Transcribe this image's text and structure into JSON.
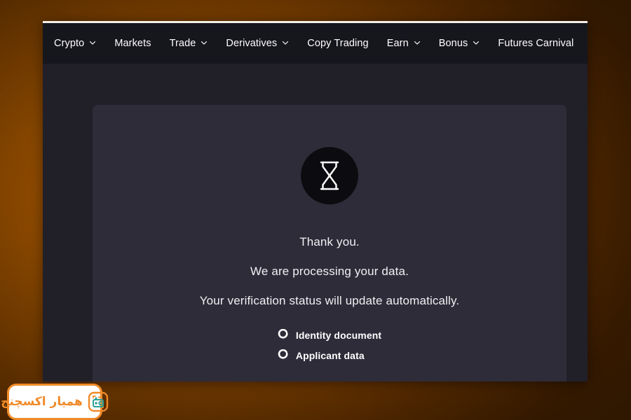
{
  "nav": {
    "items": [
      {
        "label": "Crypto",
        "has_chevron": true
      },
      {
        "label": "Markets",
        "has_chevron": false
      },
      {
        "label": "Trade",
        "has_chevron": true
      },
      {
        "label": "Derivatives",
        "has_chevron": true
      },
      {
        "label": "Copy Trading",
        "has_chevron": false
      },
      {
        "label": "Earn",
        "has_chevron": true
      },
      {
        "label": "Bonus",
        "has_chevron": true
      },
      {
        "label": "Futures Carnival",
        "has_chevron": false
      }
    ]
  },
  "card": {
    "icon": "hourglass-icon",
    "message_line_1": "Thank you.",
    "message_line_2": "We are processing your data.",
    "message_line_3": "Your verification status will update automatically.",
    "status_items": [
      {
        "label": "Identity document",
        "icon": "spinner-icon"
      },
      {
        "label": "Applicant data",
        "icon": "spinner-icon"
      }
    ]
  },
  "watermark": {
    "text": "همیار اکسچنج",
    "icon": "exchange-wallet-logo"
  },
  "colors": {
    "page_background": "#212029",
    "nav_background": "#16161d",
    "card_background": "#2e2c39",
    "icon_circle": "#0c0c10",
    "text_primary": "#f0f0f3",
    "accent_orange": "#f08a28",
    "accent_green": "#2aa198",
    "desktop_gradient_from": "#9b5200",
    "desktop_gradient_to": "#3a1c00"
  }
}
